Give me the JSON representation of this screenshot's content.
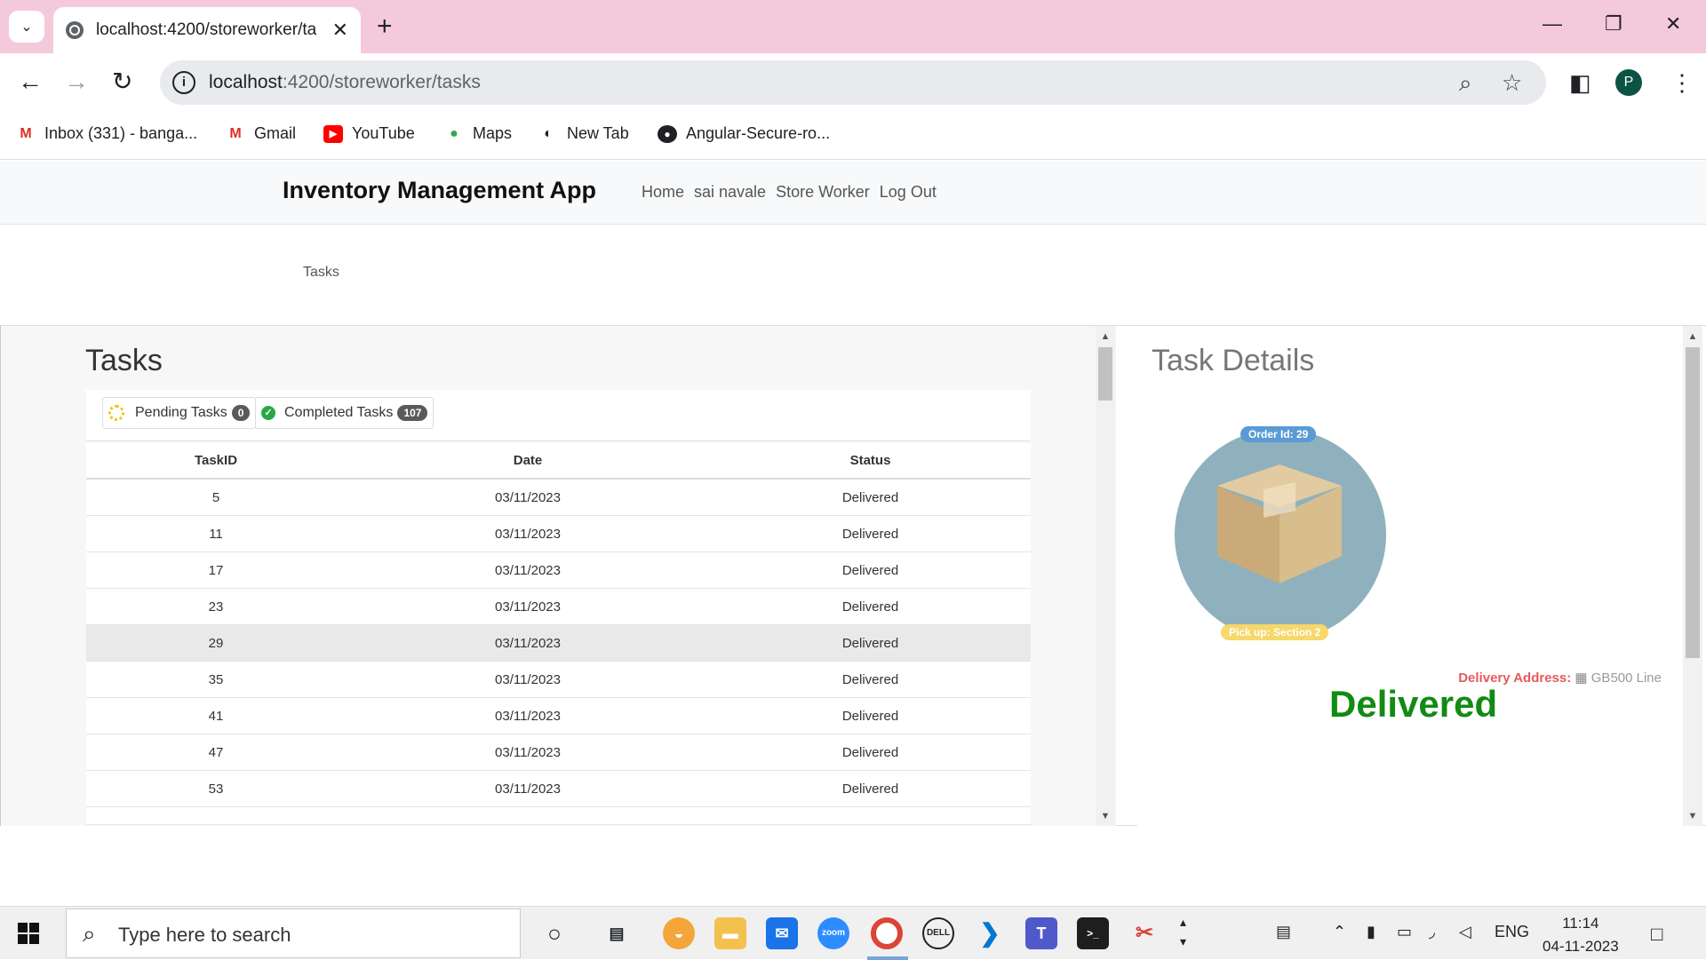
{
  "browser": {
    "tab_title": "localhost:4200/storeworker/ta",
    "url_host": "localhost",
    "url_path": ":4200/storeworker/tasks",
    "bookmarks": [
      {
        "label": "Inbox (331) - banga...",
        "icon": "gmail-icon",
        "color": "#d93025"
      },
      {
        "label": "Gmail",
        "icon": "gmail-icon",
        "color": "#d93025"
      },
      {
        "label": "YouTube",
        "icon": "youtube-icon",
        "color": "#ff0000"
      },
      {
        "label": "Maps",
        "icon": "maps-icon",
        "color": "#34a853"
      },
      {
        "label": "New Tab",
        "icon": "globe-icon",
        "color": "#202124"
      },
      {
        "label": "Angular-Secure-ro...",
        "icon": "github-icon",
        "color": "#202124"
      }
    ],
    "profile_initial": "P"
  },
  "app": {
    "brand": "Inventory Management App",
    "nav": {
      "home": "Home",
      "user": "sai navale",
      "role": "Store Worker",
      "logout": "Log Out"
    },
    "breadcrumb": "Tasks"
  },
  "tasks": {
    "heading": "Tasks",
    "pending_label": "Pending Tasks",
    "pending_count": "0",
    "completed_label": "Completed Tasks",
    "completed_count": "107",
    "columns": {
      "id": "TaskID",
      "date": "Date",
      "status": "Status"
    },
    "rows": [
      {
        "id": "5",
        "date": "03/11/2023",
        "status": "Delivered"
      },
      {
        "id": "11",
        "date": "03/11/2023",
        "status": "Delivered"
      },
      {
        "id": "17",
        "date": "03/11/2023",
        "status": "Delivered"
      },
      {
        "id": "23",
        "date": "03/11/2023",
        "status": "Delivered"
      },
      {
        "id": "29",
        "date": "03/11/2023",
        "status": "Delivered",
        "selected": true
      },
      {
        "id": "35",
        "date": "03/11/2023",
        "status": "Delivered"
      },
      {
        "id": "41",
        "date": "03/11/2023",
        "status": "Delivered"
      },
      {
        "id": "47",
        "date": "03/11/2023",
        "status": "Delivered"
      },
      {
        "id": "53",
        "date": "03/11/2023",
        "status": "Delivered"
      }
    ]
  },
  "details": {
    "heading": "Task Details",
    "order_tag": "Order Id: 29",
    "pickup_tag": "Pick up: Section 2",
    "delivery_label": "Delivery Address:",
    "delivery_value": "GB500 Line",
    "status": "Delivered",
    "colors": {
      "delivered": "#138a13",
      "delivery_label": "#e55a5a"
    }
  },
  "taskbar": {
    "search_placeholder": "Type here to search",
    "language": "ENG",
    "time": "11:14",
    "date": "04-11-2023"
  }
}
